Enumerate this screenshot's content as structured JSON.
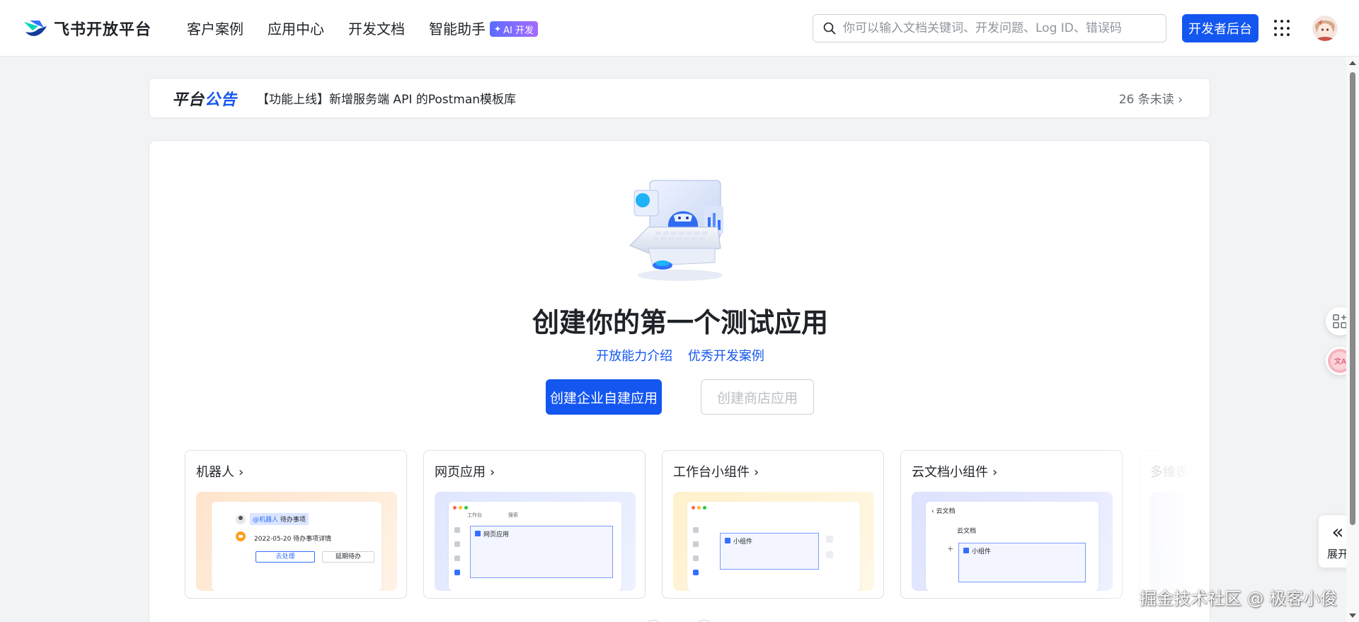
{
  "header": {
    "logo_text": "飞书开放平台",
    "nav": [
      {
        "label": "客户案例"
      },
      {
        "label": "应用中心"
      },
      {
        "label": "开发文档"
      },
      {
        "label": "智能助手"
      }
    ],
    "ai_badge": "AI 开发",
    "search_placeholder": "你可以输入文档关键词、开发问题、Log ID、错误码",
    "dev_console_label": "开发者后台"
  },
  "announcement": {
    "title_part1": "平台",
    "title_part2": "公告",
    "text": "【功能上线】新增服务端 API 的Postman模板库",
    "unread": "26 条未读"
  },
  "main": {
    "title": "创建你的第一个测试应用",
    "links": [
      "开放能力介绍",
      "优秀开发案例"
    ],
    "primary_button": "创建企业自建应用",
    "secondary_button": "创建商店应用",
    "app_types": [
      {
        "title": "机器人",
        "preview": {
          "bot_tag": "@机器人",
          "bot_tag_title": "待办事项",
          "todo_line": "2022-05-20 待办事项详情",
          "btn1": "去处理",
          "btn2": "延期待办"
        }
      },
      {
        "title": "网页应用",
        "preview": {
          "tab1": "工作台",
          "tab2": "搜索",
          "box": "网页应用"
        }
      },
      {
        "title": "工作台小组件",
        "preview": {
          "box": "小组件"
        }
      },
      {
        "title": "云文档小组件",
        "preview": {
          "header": "云文档",
          "doc_title": "云文档",
          "box": "小组件"
        }
      },
      {
        "title": "多维表格"
      }
    ]
  },
  "side": {
    "expand_label": "展开"
  },
  "watermark": "掘金技术社区 @ 极客小俊",
  "colors": {
    "brand": "#1456f0",
    "text": "#1f2329",
    "muted": "#646a73",
    "bg": "#f2f3f5"
  }
}
